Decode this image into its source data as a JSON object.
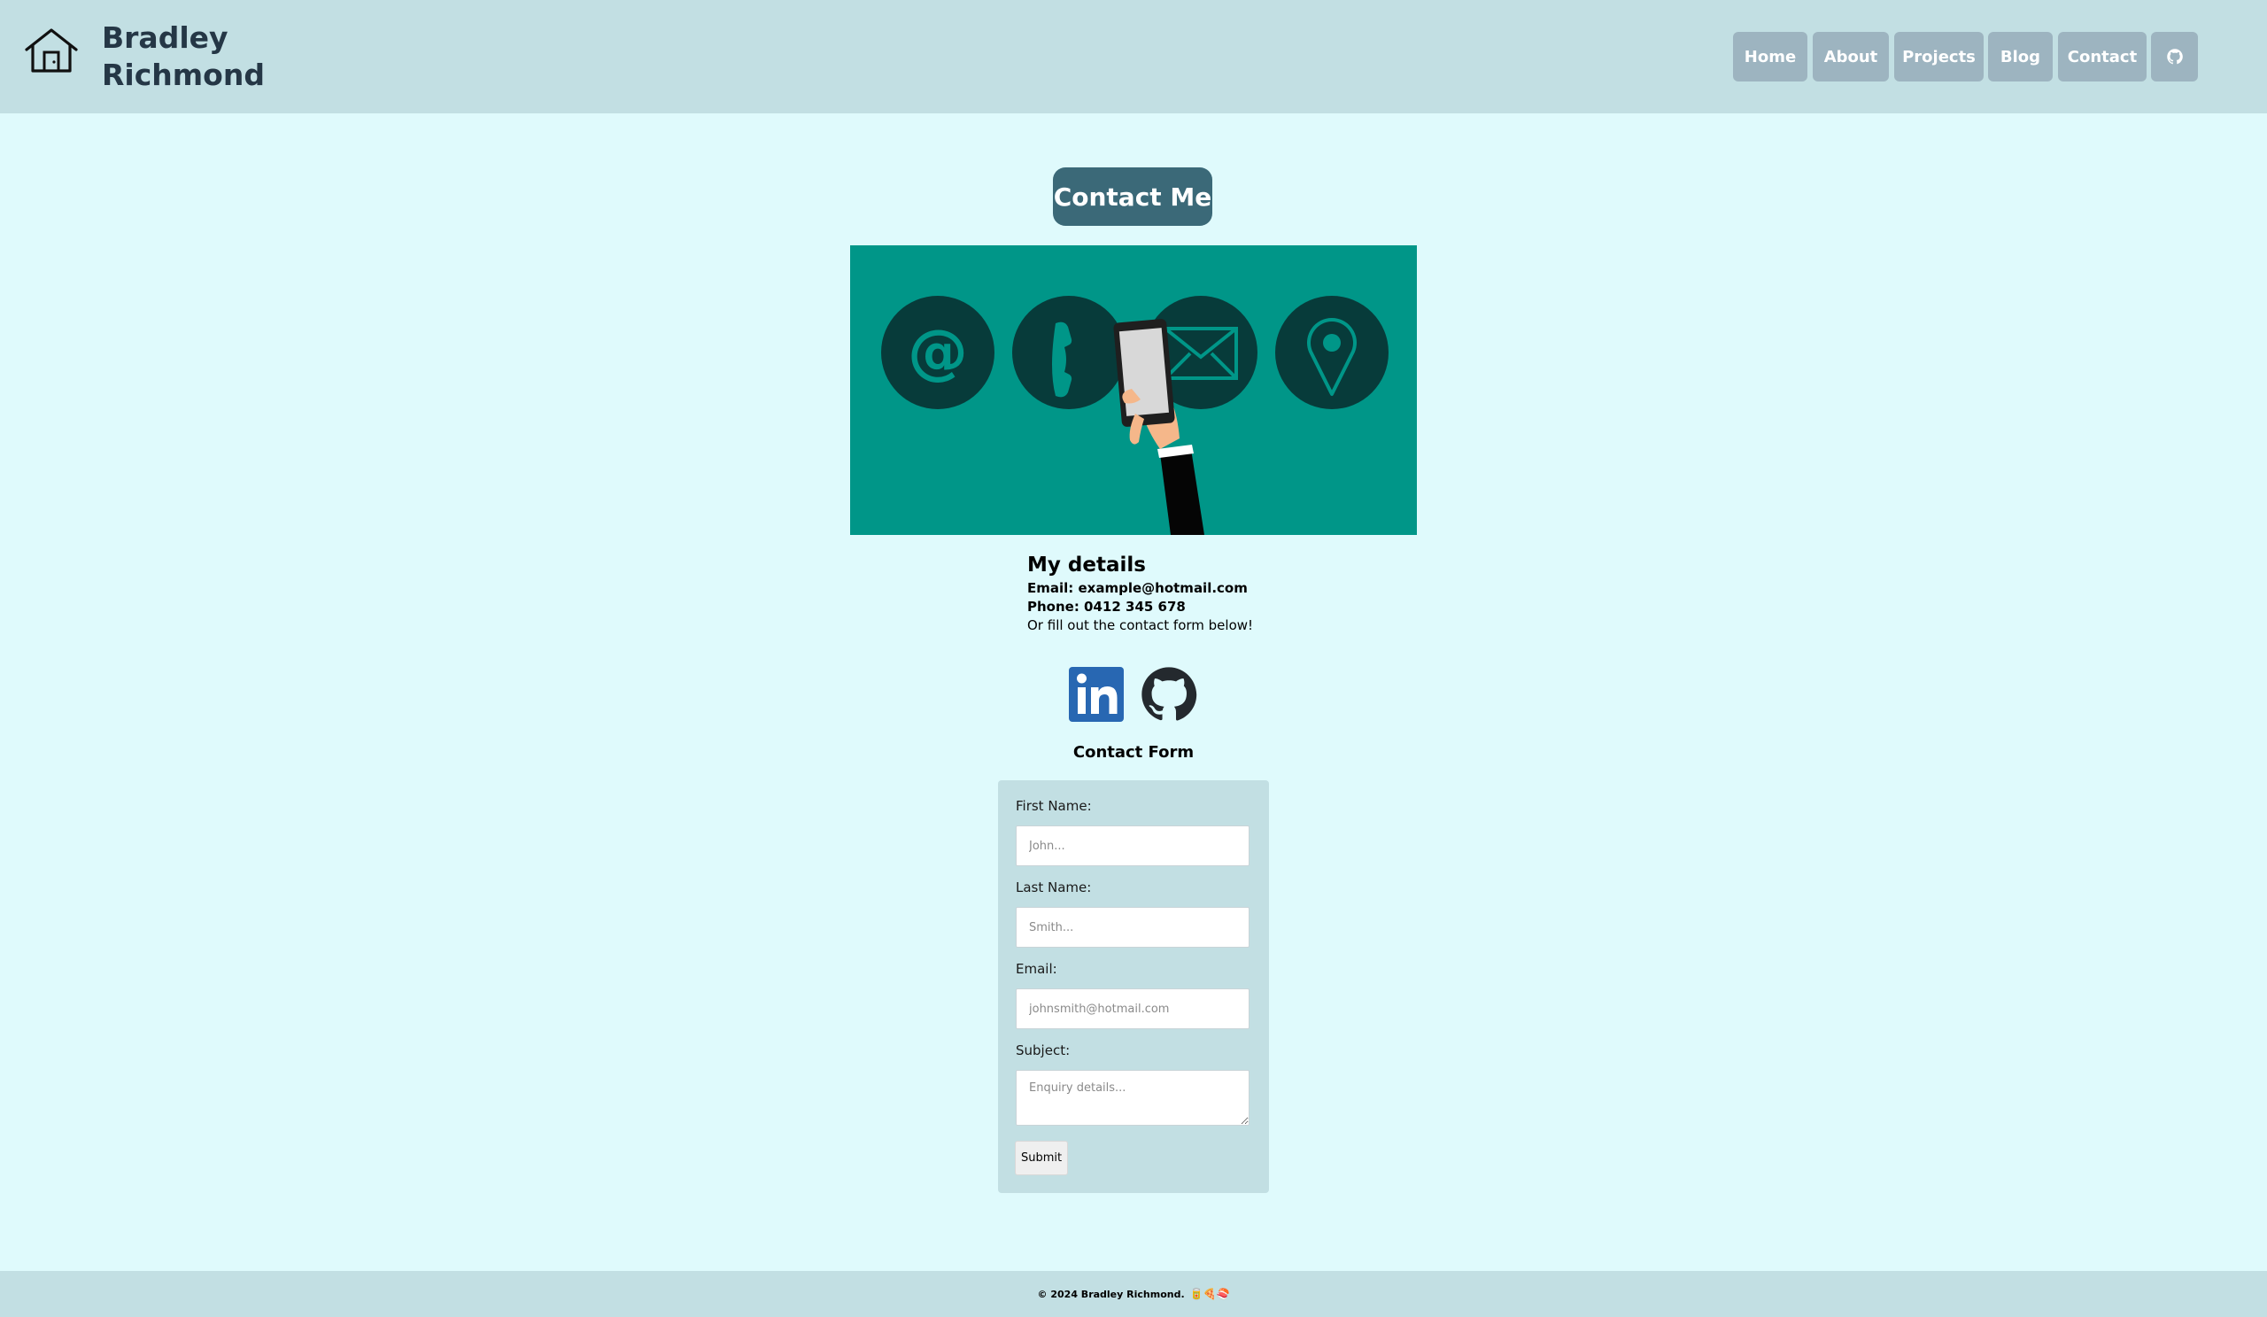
{
  "header": {
    "brand_line1": "Bradley",
    "brand_line2": "Richmond",
    "nav": [
      {
        "label": "Home"
      },
      {
        "label": "About"
      },
      {
        "label": "Projects"
      },
      {
        "label": "Blog"
      },
      {
        "label": "Contact"
      }
    ],
    "github_icon": "github-icon"
  },
  "main": {
    "title": "Contact Me",
    "details": {
      "heading": "My details",
      "email": "Email: example@hotmail.com",
      "phone": "Phone: 0412 345 678",
      "note": "Or fill out the contact form below!"
    },
    "socials": [
      "linkedin-icon",
      "github-icon"
    ],
    "form": {
      "heading": "Contact Form",
      "first_name_label": "First Name:",
      "first_name_placeholder": "John...",
      "last_name_label": "Last Name:",
      "last_name_placeholder": "Smith...",
      "email_label": "Email:",
      "email_placeholder": "johnsmith@hotmail.com",
      "subject_label": "Subject:",
      "subject_placeholder": "Enquiry details...",
      "submit_label": "Submit"
    }
  },
  "footer": {
    "text": "© 2024 Bradley Richmond.",
    "emoji": "🥫🍕🍣"
  },
  "colors": {
    "background": "#dffafc",
    "header": "#c2dfe3",
    "nav_button": "#9db4c0",
    "title_button": "#3b6978",
    "hero_teal": "#009688"
  }
}
